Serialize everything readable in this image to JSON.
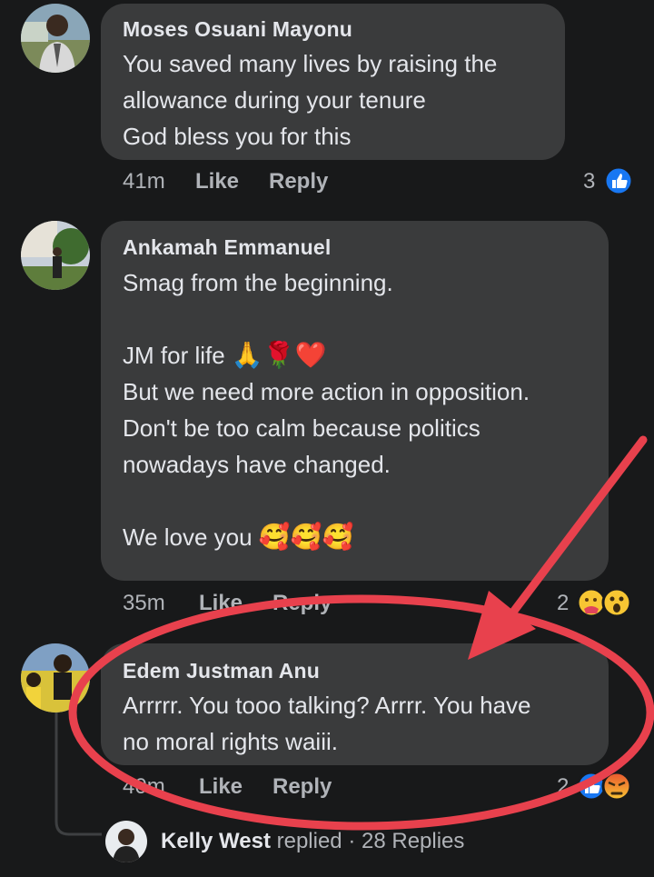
{
  "comments": [
    {
      "author": "Moses Osuani Mayonu",
      "lines": [
        "You saved many lives by raising the",
        "allowance during your tenure",
        "God bless you for this"
      ],
      "time": "41m",
      "like": "Like",
      "reply": "Reply",
      "reaction_count": "3"
    },
    {
      "author": "Ankamah Emmanuel",
      "lines": [
        "Smag from the beginning.",
        "",
        "JM for life",
        "But we need more action in opposition.",
        "Don't be too calm because politics",
        "nowadays have changed.",
        "",
        "We love you"
      ],
      "emoji_jm": "🙏🌹❤️",
      "emoji_love": "🥰🥰🥰",
      "time": "35m",
      "like": "Like",
      "reply": "Reply",
      "reaction_count": "2"
    },
    {
      "author": "Edem Justman Anu",
      "lines": [
        "Arrrrr. You tooo talking? Arrrr. You have",
        "no moral rights waiii."
      ],
      "time": "40m",
      "like": "Like",
      "reply": "Reply",
      "reaction_count": "2"
    }
  ],
  "reply_summary": {
    "name": "Kelly West",
    "verb": "replied",
    "separator": "·",
    "replies": "28 Replies"
  },
  "colors": {
    "background": "#18191a",
    "bubble": "#3a3b3c",
    "annotation": "#e8414d",
    "like_blue": "#1877f2",
    "haha_yellow": "#f7c633"
  },
  "icons": [
    "like-reaction-icon",
    "care-reaction-icon",
    "wow-reaction-icon",
    "angry-reaction-icon",
    "annotation-arrow",
    "annotation-circle"
  ]
}
